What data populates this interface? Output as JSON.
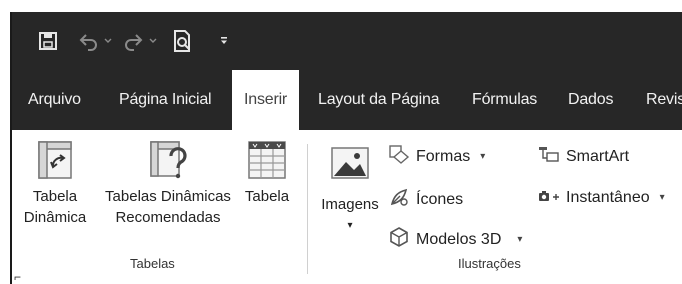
{
  "quick_access": {
    "icons": [
      "save-icon",
      "undo-icon",
      "redo-icon",
      "print-preview-icon",
      "customize-toolbar-icon"
    ]
  },
  "tabs": [
    {
      "label": "Arquivo"
    },
    {
      "label": "Página Inicial"
    },
    {
      "label": "Inserir",
      "active": true
    },
    {
      "label": "Layout da Página"
    },
    {
      "label": "Fórmulas"
    },
    {
      "label": "Dados"
    },
    {
      "label": "Revis"
    }
  ],
  "groups": {
    "tabelas": {
      "label": "Tabelas",
      "buttons": [
        {
          "line1": "Tabela",
          "line2": "Dinâmica",
          "icon": "pivot-table-icon"
        },
        {
          "line1": "Tabelas Dinâmicas",
          "line2": "Recomendadas",
          "icon": "recommended-pivot-icon"
        },
        {
          "line1": "Tabela",
          "line2": "",
          "icon": "table-icon"
        }
      ]
    },
    "ilustracoes": {
      "label": "Ilustrações",
      "images_button": {
        "label": "Imagens",
        "icon": "picture-icon"
      },
      "small_buttons": [
        {
          "label": "Formas",
          "icon": "shapes-icon"
        },
        {
          "label": "Ícones",
          "icon": "icons-icon"
        },
        {
          "label": "Modelos 3D",
          "icon": "3d-models-icon"
        },
        {
          "label": "SmartArt",
          "icon": "smartart-icon"
        },
        {
          "label": "Instantâneo",
          "icon": "screenshot-icon"
        }
      ]
    }
  },
  "colors": {
    "titlebar": "#272727",
    "tab_text": "#f2f2f2",
    "active_tab_text": "#444444",
    "ribbon_bg": "#ffffff"
  }
}
